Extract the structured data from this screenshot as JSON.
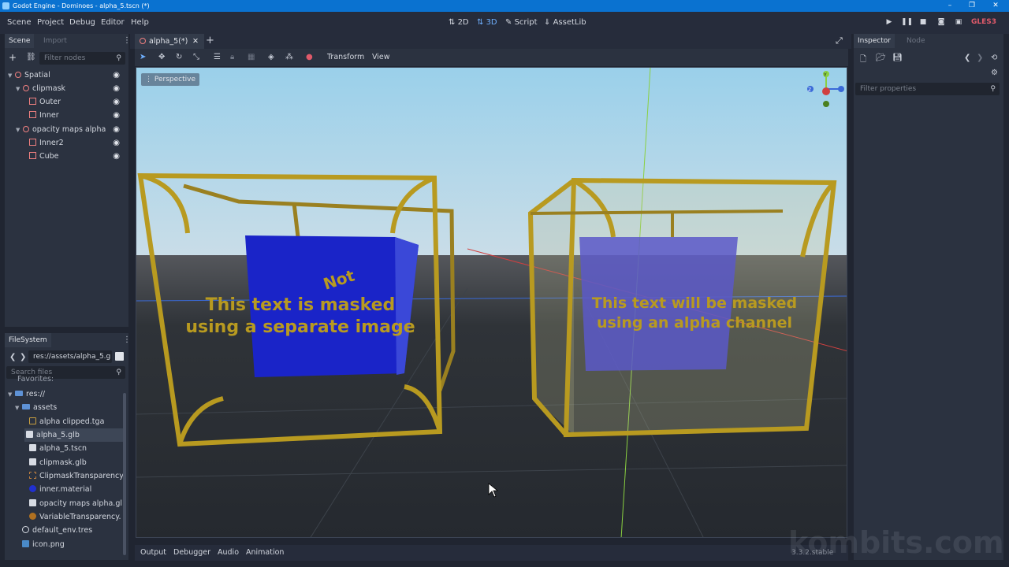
{
  "window": {
    "title": "Godot Engine - Dominoes - alpha_5.tscn (*)"
  },
  "menu": {
    "items": [
      "Scene",
      "Project",
      "Debug",
      "Editor",
      "Help"
    ]
  },
  "workspaces": {
    "btn2d": "2D",
    "btn3d": "3D",
    "script": "Script",
    "assetlib": "AssetLib"
  },
  "renderer": "GLES3",
  "scene_dock": {
    "tab_scene": "Scene",
    "tab_import": "Import",
    "filter_placeholder": "Filter nodes",
    "nodes": [
      {
        "label": "Spatial"
      },
      {
        "label": "clipmask"
      },
      {
        "label": "Outer"
      },
      {
        "label": "Inner"
      },
      {
        "label": "opacity maps alpha"
      },
      {
        "label": "Inner2"
      },
      {
        "label": "Cube"
      }
    ]
  },
  "filesystem_dock": {
    "tab": "FileSystem",
    "path": "res://assets/alpha_5.g",
    "search_placeholder": "Search files",
    "items": [
      {
        "label": "Favorites:"
      },
      {
        "label": "res://"
      },
      {
        "label": "assets"
      },
      {
        "label": "alpha clipped.tga"
      },
      {
        "label": "alpha_5.glb"
      },
      {
        "label": "alpha_5.tscn"
      },
      {
        "label": "clipmask.glb"
      },
      {
        "label": "ClipmaskTransparency"
      },
      {
        "label": "inner.material"
      },
      {
        "label": "opacity maps alpha.gl"
      },
      {
        "label": "VariableTransparency."
      },
      {
        "label": "default_env.tres"
      },
      {
        "label": "icon.png"
      }
    ]
  },
  "editor_tab": {
    "label": "alpha_5(*)"
  },
  "viewport_toolbar": {
    "transform": "Transform",
    "view": "View"
  },
  "viewport": {
    "perspective_label": "Perspective",
    "gizmo_y": "Y",
    "gizmo_z": "Z",
    "left_text_line1": "This text is masked",
    "left_text_line2": "using a separate image",
    "left_text_not": "Not",
    "right_text_line1": "This text will be masked",
    "right_text_line2": "using an alpha channel"
  },
  "inspector": {
    "tab_inspector": "Inspector",
    "tab_node": "Node",
    "filter_placeholder": "Filter properties"
  },
  "bottom_panel": {
    "tabs": [
      "Output",
      "Debugger",
      "Audio",
      "Animation"
    ],
    "version": "3.3.2.stable"
  },
  "watermark": "kombits.com",
  "colors": {
    "titlebar": "#0a72d0",
    "accent": "#6fb0ff",
    "renderer": "#e05a6a",
    "node_icon": "#f08080",
    "frame": "#b89a20",
    "cube": "#1f2ccf"
  }
}
